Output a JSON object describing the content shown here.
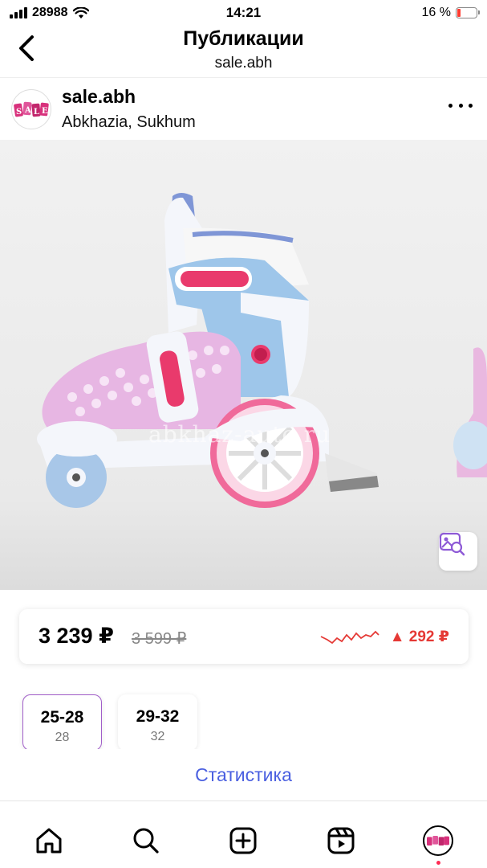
{
  "status_bar": {
    "carrier": "28988",
    "time": "14:21",
    "battery": "16 %"
  },
  "nav": {
    "title": "Публикации",
    "subtitle": "sale.abh"
  },
  "post": {
    "username": "sale.abh",
    "location": "Abkhazia, Sukhum",
    "avatar_text": "SALE",
    "watermark": "abkhaz-auto.ru"
  },
  "price": {
    "current": "3 239 ₽",
    "old": "3 599 ₽",
    "diff": "▲ 292 ₽",
    "diff_color": "#e53935"
  },
  "sizes": [
    {
      "range": "25-28",
      "sub": "28",
      "selected": true
    },
    {
      "range": "29-32",
      "sub": "32",
      "selected": false
    }
  ],
  "stats": {
    "label": "Статистика",
    "color": "#4a5fe0"
  },
  "tabbar": {
    "items": [
      "home-icon",
      "search-icon",
      "new-post-icon",
      "reels-icon",
      "profile-avatar"
    ]
  }
}
